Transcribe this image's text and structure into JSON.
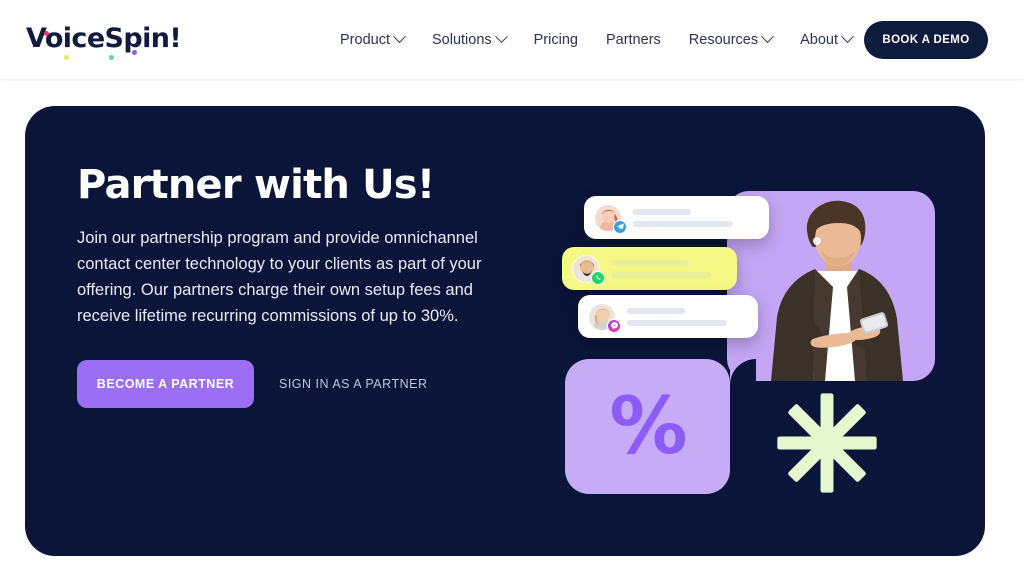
{
  "header": {
    "logo": {
      "text": "VoiceSpin!",
      "dots": [
        "red-dot",
        "yellow-dot",
        "green-dot",
        "purple-dot"
      ],
      "colors": {
        "text": "#101b3d",
        "red": "#f2385a",
        "yellow": "#f6e05e",
        "green": "#5fd6a8",
        "purple": "#8b5cf6"
      }
    },
    "nav": [
      {
        "label": "Product",
        "has_chevron": true,
        "name": "product"
      },
      {
        "label": "Solutions",
        "has_chevron": true,
        "name": "solutions"
      },
      {
        "label": "Pricing",
        "has_chevron": false,
        "name": "pricing"
      },
      {
        "label": "Partners",
        "has_chevron": false,
        "name": "partners"
      },
      {
        "label": "Resources",
        "has_chevron": true,
        "name": "resources"
      },
      {
        "label": "About",
        "has_chevron": true,
        "name": "about"
      }
    ],
    "cta": {
      "label": "BOOK A DEMO",
      "bg": "#0e1b3d",
      "color": "#ffffff"
    }
  },
  "hero": {
    "bg": "#0b1539",
    "title": "Partner with Us!",
    "paragraph": "Join our partnership program and provide omnichannel contact center technology to your clients as part of your offering. Our partners charge their own setup fees and receive lifetime recurring commissions of up to 30%.",
    "primary_button": {
      "label": "BECOME A PARTNER",
      "bg": "#9b6ef3",
      "color": "#ffffff"
    },
    "secondary_link": {
      "label": "SIGN IN AS A PARTNER",
      "color": "#b9c6e2"
    }
  },
  "illustration": {
    "chat_cards": [
      {
        "id": "chat-card-telegram",
        "channel": "telegram-icon",
        "avatar": "female-avatar",
        "bg": "#ffffff",
        "badge_color": "#2fa4e0"
      },
      {
        "id": "chat-card-whatsapp",
        "channel": "whatsapp-icon",
        "avatar": "male-avatar",
        "bg": "#f5f885",
        "badge_color": "#25d366"
      },
      {
        "id": "chat-card-messenger",
        "channel": "messenger-icon",
        "avatar": "female-avatar",
        "bg": "#ffffff",
        "badge_color": "#9b4df0"
      }
    ],
    "photo_panel": {
      "name": "man-with-phone-photo",
      "bg": "#c3a6f5"
    },
    "percent_panel": {
      "symbol": "%",
      "bg": "#c6abf6",
      "symbol_color": "#8b5cf6"
    },
    "star": {
      "name": "asterisk-star-icon",
      "color": "#e4f7cf",
      "points": 8
    }
  }
}
